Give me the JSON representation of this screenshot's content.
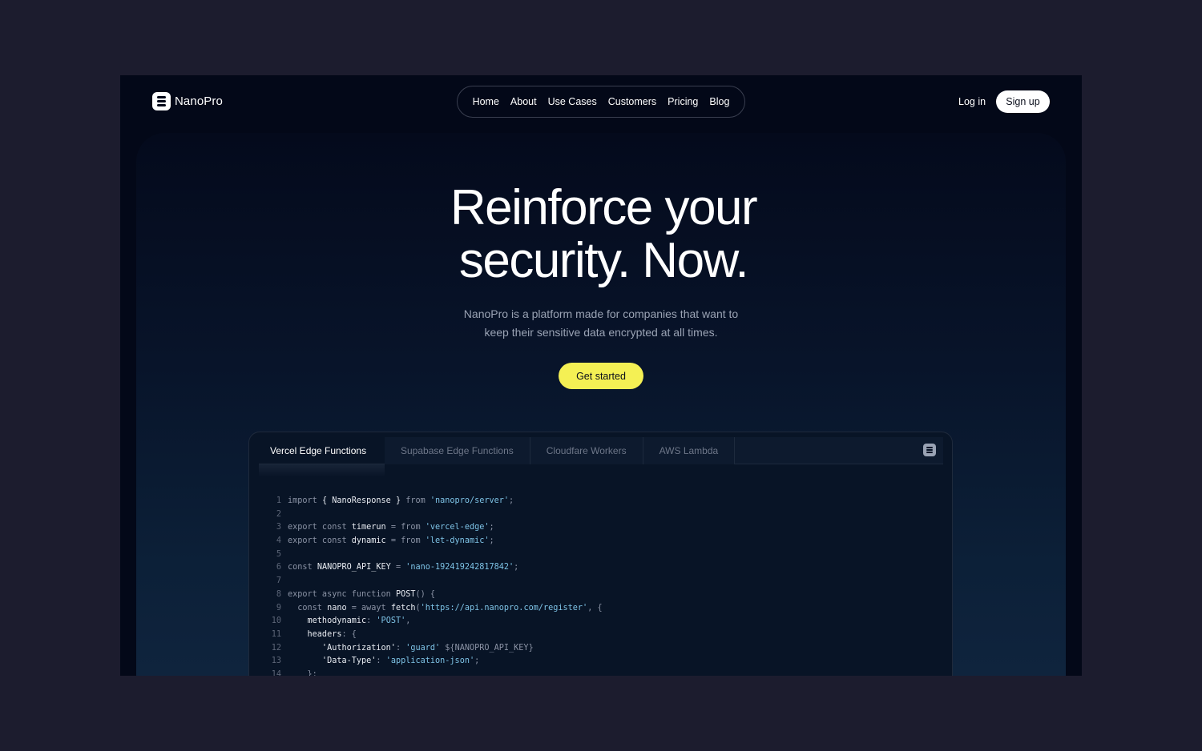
{
  "brand": {
    "name": "NanoPro"
  },
  "nav": {
    "links": [
      "Home",
      "About",
      "Use Cases",
      "Customers",
      "Pricing",
      "Blog"
    ],
    "login": "Log in",
    "signup": "Sign up"
  },
  "hero": {
    "headline_line1": "Reinforce your",
    "headline_line2": "security. Now.",
    "subtitle_line1": "NanoPro is a platform made for companies that want to",
    "subtitle_line2": "keep their sensitive data encrypted at all times.",
    "cta": "Get started"
  },
  "code_panel": {
    "tabs": [
      "Vercel Edge Functions",
      "Supabase Edge Functions",
      "Cloudfare Workers",
      "AWS Lambda"
    ],
    "active_tab": 0,
    "lines": [
      [
        [
          "k",
          "import "
        ],
        [
          "w",
          "{ NanoResponse } "
        ],
        [
          "k",
          "from "
        ],
        [
          "s",
          "'nanopro/server'"
        ],
        [
          "k",
          ";"
        ]
      ],
      [],
      [
        [
          "k",
          "export const "
        ],
        [
          "w",
          "timerun "
        ],
        [
          "k",
          "= from "
        ],
        [
          "s",
          "'vercel-edge'"
        ],
        [
          "k",
          ";"
        ]
      ],
      [
        [
          "k",
          "export const "
        ],
        [
          "w",
          "dynamic "
        ],
        [
          "k",
          "= from "
        ],
        [
          "s",
          "'let-dynamic'"
        ],
        [
          "k",
          ";"
        ]
      ],
      [],
      [
        [
          "k",
          "const "
        ],
        [
          "w",
          "NANOPRO_API_KEY "
        ],
        [
          "k",
          "= "
        ],
        [
          "s",
          "'nano-192419242817842'"
        ],
        [
          "k",
          ";"
        ]
      ],
      [],
      [
        [
          "k",
          "export async function "
        ],
        [
          "w",
          "POST"
        ],
        [
          "k",
          "() {"
        ]
      ],
      [
        [
          "k",
          "  const "
        ],
        [
          "w",
          "nano "
        ],
        [
          "k",
          "= awayt "
        ],
        [
          "w",
          "fetch"
        ],
        [
          "k",
          "("
        ],
        [
          "s",
          "'https://api.nanopro.com/register'"
        ],
        [
          "k",
          ", {"
        ]
      ],
      [
        [
          "w",
          "    methodynamic"
        ],
        [
          "k",
          ": "
        ],
        [
          "s",
          "'POST'"
        ],
        [
          "k",
          ","
        ]
      ],
      [
        [
          "w",
          "    headers"
        ],
        [
          "k",
          ": {"
        ]
      ],
      [
        [
          "w",
          "       'Authorization'"
        ],
        [
          "k",
          ": "
        ],
        [
          "s",
          "'guard' "
        ],
        [
          "k",
          "${NANOPRO_API_KEY}"
        ]
      ],
      [
        [
          "w",
          "       'Data-Type'"
        ],
        [
          "k",
          ": "
        ],
        [
          "s",
          "'application-json'"
        ],
        [
          "k",
          ";"
        ]
      ],
      [
        [
          "k",
          "    };"
        ]
      ]
    ]
  },
  "colors": {
    "page_bg": "#1c1c2e",
    "frame_bg": "#030818",
    "accent": "#f4f054",
    "code_string": "#7ec3e6"
  }
}
